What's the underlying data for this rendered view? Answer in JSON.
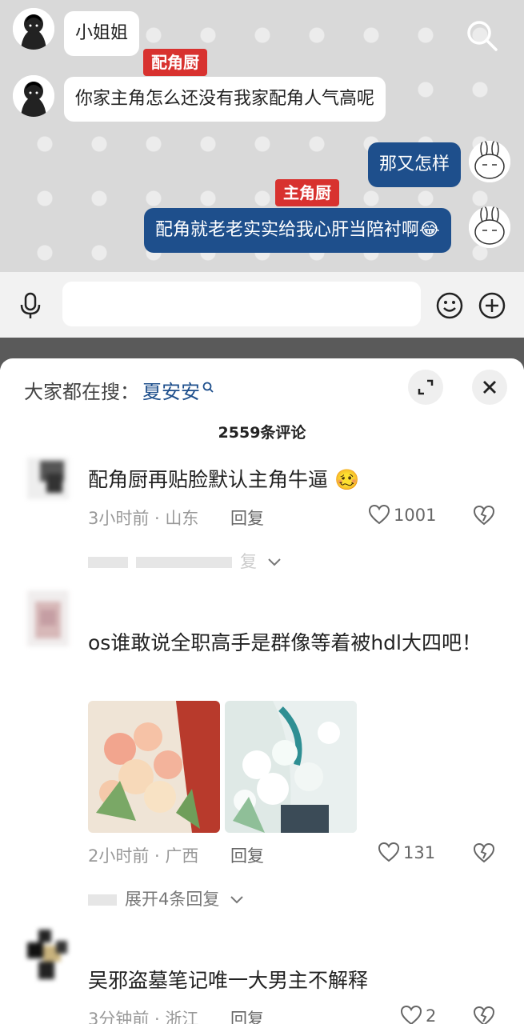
{
  "chat": {
    "messages": [
      {
        "side": "left",
        "text": "小姐姐",
        "tag": ""
      },
      {
        "side": "left",
        "text": "你家主角怎么还没有我家配角人气高呢",
        "tag": "配角厨"
      },
      {
        "side": "right",
        "text": "那又怎样",
        "tag": ""
      },
      {
        "side": "right",
        "text": "配角就老老实实给我心肝当陪衬啊😂",
        "tag": "主角厨"
      }
    ]
  },
  "inputbar": {
    "icons": [
      "microphone-icon",
      "emoji-icon",
      "plus-icon"
    ]
  },
  "sheet": {
    "hot_prefix": "大家都在搜：",
    "hot_keyword": "夏安安",
    "comment_count": "2559条评论",
    "comments": [
      {
        "text": "配角厨再贴脸默认主角牛逼 🥴",
        "time_loc": "3小时前 · 山东",
        "reply": "回复",
        "likes": "1001",
        "expand": "复"
      },
      {
        "name": "",
        "text": "os谁敢说全职高手是群像等着被hdl大四吧！",
        "time_loc": "2小时前 · 广西",
        "reply": "回复",
        "likes": "131",
        "expand": "展开4条回复",
        "images": [
          "bouquet-image-1",
          "bouquet-image-2"
        ]
      },
      {
        "name": "",
        "text": "吴邪盗墓笔记唯一大男主不解释",
        "time_loc": "3分钟前 · 浙江",
        "reply": "回复",
        "likes": "2"
      }
    ]
  },
  "colors": {
    "bubble_blue": "#1e4f8c",
    "tag_red": "#d8322f",
    "chat_bg": "#d9d9d9"
  }
}
